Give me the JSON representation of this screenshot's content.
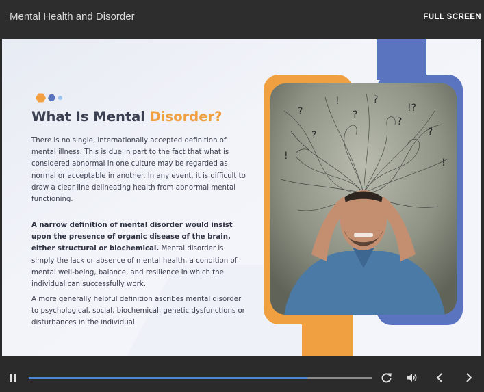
{
  "window": {
    "title": "Mental Health and Disorder",
    "fullscreen_label": "FULL SCREEN"
  },
  "slide": {
    "heading_main": "What Is Mental ",
    "heading_accent": "Disorder?",
    "paragraph1": "There is no single, internationally accepted definition of mental illness. This is due in part to the fact that what is considered abnormal in one culture may be regarded as normal or acceptable in another. In any event, it is difficult to draw a clear line delineating health from abnormal mental functioning.",
    "paragraph2_bold": "A narrow definition of mental disorder would insist upon the presence of organic disease of the brain, either structural or biochemical.",
    "paragraph2_rest": " Mental disorder is simply the lack or absence of mental health, a condition of mental well-being, balance, and resilience in which the individual can successfully work.",
    "paragraph3": "A more generally helpful definition ascribes mental disorder to psychological, social, biochemical, genetic dysfunctions or disturbances in the individual."
  },
  "player": {
    "progress_fraction": 0.81,
    "icons": {
      "play_pause": "pause-icon",
      "replay": "replay-icon",
      "volume": "volume-icon",
      "previous": "chevron-left-icon",
      "next": "chevron-right-icon"
    }
  },
  "colors": {
    "accent_orange": "#f0a040",
    "accent_blue": "#5b74bf",
    "progress_fill": "#4f86d2",
    "heading_dark": "#3a3f51"
  }
}
